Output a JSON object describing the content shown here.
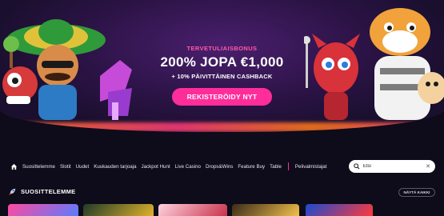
{
  "hero": {
    "kicker": "TERVETULIAISBONUS",
    "title": "200% JOPA €1,000",
    "subtitle": "+ 10% PÄIVITTÄINEN CASHBACK",
    "cta_label": "REKISTERÖIDY NYT"
  },
  "nav": {
    "items": [
      "Suosittelemme",
      "Slotit",
      "Uudet",
      "Kuukauden tarjoaja",
      "Jackpot Hunt",
      "Live Casino",
      "Drops&Wins",
      "Feature Buy",
      "Table"
    ],
    "providers_label": "Pelivalmistajat"
  },
  "search": {
    "value": "Etsi"
  },
  "section": {
    "title": "SUOSITTELEMME",
    "show_all": "NÄYTÄ KAIKKI"
  },
  "colors": {
    "accent": "#ff2d9a",
    "background": "#0e0b1a"
  },
  "icons": [
    "home-icon",
    "search-icon",
    "close-icon",
    "rocket-icon"
  ]
}
